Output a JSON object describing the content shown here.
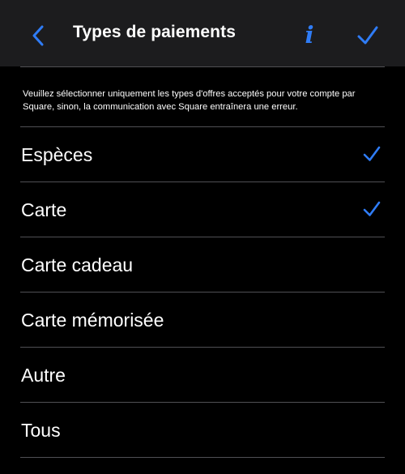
{
  "colors": {
    "accent": "#2f7cf6",
    "navbar_bg": "#1c1c1e",
    "background": "#000000",
    "separator": "#505054",
    "text": "#ffffff"
  },
  "navbar": {
    "back_icon": "chevron-left-icon",
    "title": "Types de paiements",
    "info_label": "i",
    "done_icon": "checkmark-icon"
  },
  "notice": "Veuillez sélectionner uniquement les types d'offres acceptés pour votre compte par Square, sinon, la communication avec Square entraînera une erreur.",
  "payment_types": [
    {
      "label": "Espèces",
      "selected": true
    },
    {
      "label": "Carte",
      "selected": true
    },
    {
      "label": "Carte cadeau",
      "selected": false
    },
    {
      "label": "Carte mémorisée",
      "selected": false
    },
    {
      "label": "Autre",
      "selected": false
    },
    {
      "label": "Tous",
      "selected": false
    }
  ]
}
